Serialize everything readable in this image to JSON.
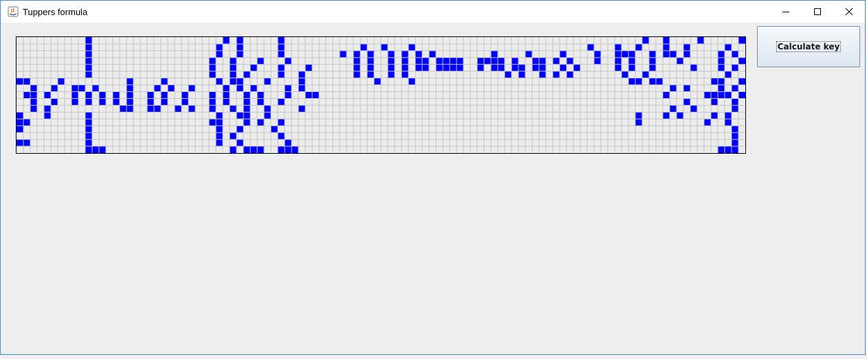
{
  "window": {
    "title": "Tuppers formula"
  },
  "toolbar": {
    "calculate_label": "Calculate key"
  },
  "grid": {
    "columns": 106,
    "rows": 17,
    "on_color": "#0000ff",
    "off_color": "#ececec",
    "line_color": "#c4c4c4",
    "pattern": [
      "..........#...................#.#.....#....................................................#..#....#.....#",
      "..........#..................#..#.....#...........#..#...#.........................#...#..#...#..#.....#",
      "..........#..................#..#.....#........#.#.#..#.#.#.#........#....#....#....#..###..#.##.#....#.#",
      "..........#.................#..#...#...#.........#.#..#.#.##.####..####.#..##.#.#...#..#.#..#...#.....#..#",
      "..........#.................#..#..#...#...#......#.#..#.#.##.####..#.##.##.##..#.#.....#.#..#.....#...#.#",
      "..........#.................#..#.#....#..#.......#.#..#.#..............#.#..#.#.#.......#..#...........#..#",
      "##....#.........#....#.......#.##...#....#..........#....#...............................##.##.......##..#",
      "..#..#..##.#....#...#.#..#....#.#.#....#.#.....................................................#.#....#.#.#",
      ".##.#...#.#.#.#.#..#.#..#...#.#..#.#...#..##..................................................#.....####.#",
      "..#..#..#.#.#.#.#..#.#..#...#.#..#.#..#..........................................................#...#..#",
      "..#.#..........##..##..#.#..#..#.#..#....#.....................................................#..#.....#",
      "#...#.....#..................#..##..#.....................................................#...#.#....#.#",
      "##........#.................##...#.#..#...................................................#.........#..#",
      "#.........#..................#..#....#..................................................................#",
      "..........#..................#.#......#.................................................................#",
      "##........#..................#..#......#................................................................#",
      "..........###..................#.###..###.............................................................###"
    ]
  }
}
